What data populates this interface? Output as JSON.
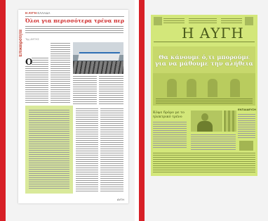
{
  "left_page": {
    "section_label": "Επικαιρότητα",
    "masthead": "Η ΑΥΓΗ",
    "masthead_section": "ΕΛΛΑΔΑ",
    "headline": "Όλοι για περισσότερα τρένα περισσότερα!",
    "byline": "Της ΑΥΓΗΣ",
    "dropcap": "Ο",
    "footer": "ΑΥΓΗ"
  },
  "right_page": {
    "logo": "Η ΑΥΓΗ",
    "hero_title_line1": "Θα κάνουμε ό,τι μπορούμε",
    "hero_title_line2": "για να μάθουμε την αλήθεια",
    "lower_title": "Κόψε δρόμο με το ηλεκτρικό τρένο",
    "side_title": "ΕΚΠΑΙΔΕΥΣΗ"
  },
  "colors": {
    "accent_red": "#d71f26",
    "highlight_green": "#d3e77a"
  }
}
